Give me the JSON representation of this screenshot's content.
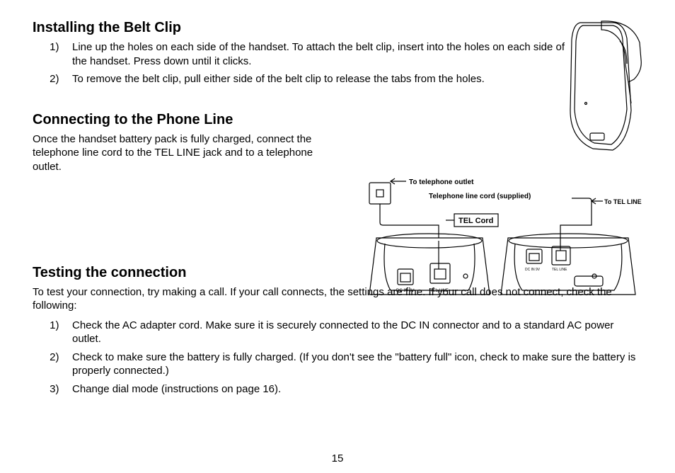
{
  "page_number": "15",
  "section1": {
    "heading": "Installing the Belt Clip",
    "items": [
      "Line up the holes on each side of the handset. To attach the belt clip, insert into the holes on each side of the handset. Press down until it clicks.",
      "To remove the belt clip, pull either side of the belt clip to release the tabs from the holes."
    ]
  },
  "section2": {
    "heading": "Connecting to the Phone Line",
    "paragraph": "Once the handset battery pack is fully charged, connect the telephone line cord to the TEL LINE jack and to a telephone outlet.",
    "figure": {
      "to_outlet": "To telephone outlet",
      "cord_supplied": "Telephone line cord (supplied)",
      "to_tel_line": "To TEL LINE",
      "tel_cord_label": "TEL Cord",
      "dc_in": "DC IN 9V",
      "tel_line_jack": "TEL LINE",
      "tel_line_jack2": "TEL LINE",
      "dc_in2": "DC IN 9V"
    }
  },
  "section3": {
    "heading": "Testing the connection",
    "paragraph": "To test your connection, try making a call. If your call connects, the settings are fine. If your call does not connect, check the following:",
    "items": [
      "Check the AC adapter cord. Make sure it is securely connected to the DC IN connector and to a standard AC power outlet.",
      "Check to make sure the battery is fully charged. (If you don't see the \"battery full\" icon, check to make sure the battery is properly connected.)",
      "Change dial mode (instructions on page 16)."
    ]
  }
}
